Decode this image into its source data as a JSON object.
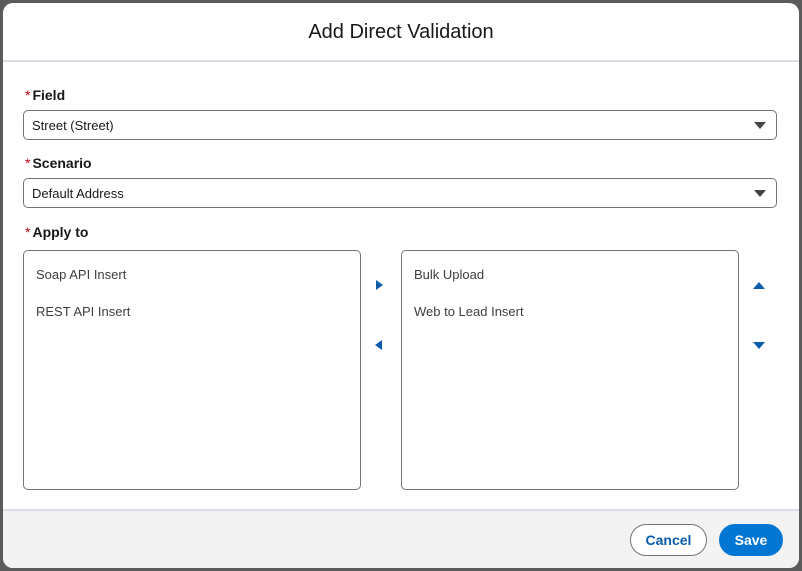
{
  "modal": {
    "title": "Add Direct Validation"
  },
  "form": {
    "required_marker": "*",
    "field": {
      "label": "Field",
      "value": "Street (Street)"
    },
    "scenario": {
      "label": "Scenario",
      "value": "Default Address"
    },
    "apply_to": {
      "label": "Apply to",
      "available_options": [
        "Soap API Insert",
        "REST API Insert"
      ],
      "selected_options": [
        "Bulk Upload",
        "Web to Lead Insert"
      ]
    }
  },
  "footer": {
    "cancel_label": "Cancel",
    "save_label": "Save"
  },
  "icons": {
    "move_right": "move-right-icon",
    "move_left": "move-left-icon",
    "move_up": "move-up-icon",
    "move_down": "move-down-icon",
    "dropdown": "chevron-down-icon"
  },
  "colors": {
    "brand": "#0176d3",
    "accent": "#0b5cab",
    "required": "#ba0517"
  }
}
